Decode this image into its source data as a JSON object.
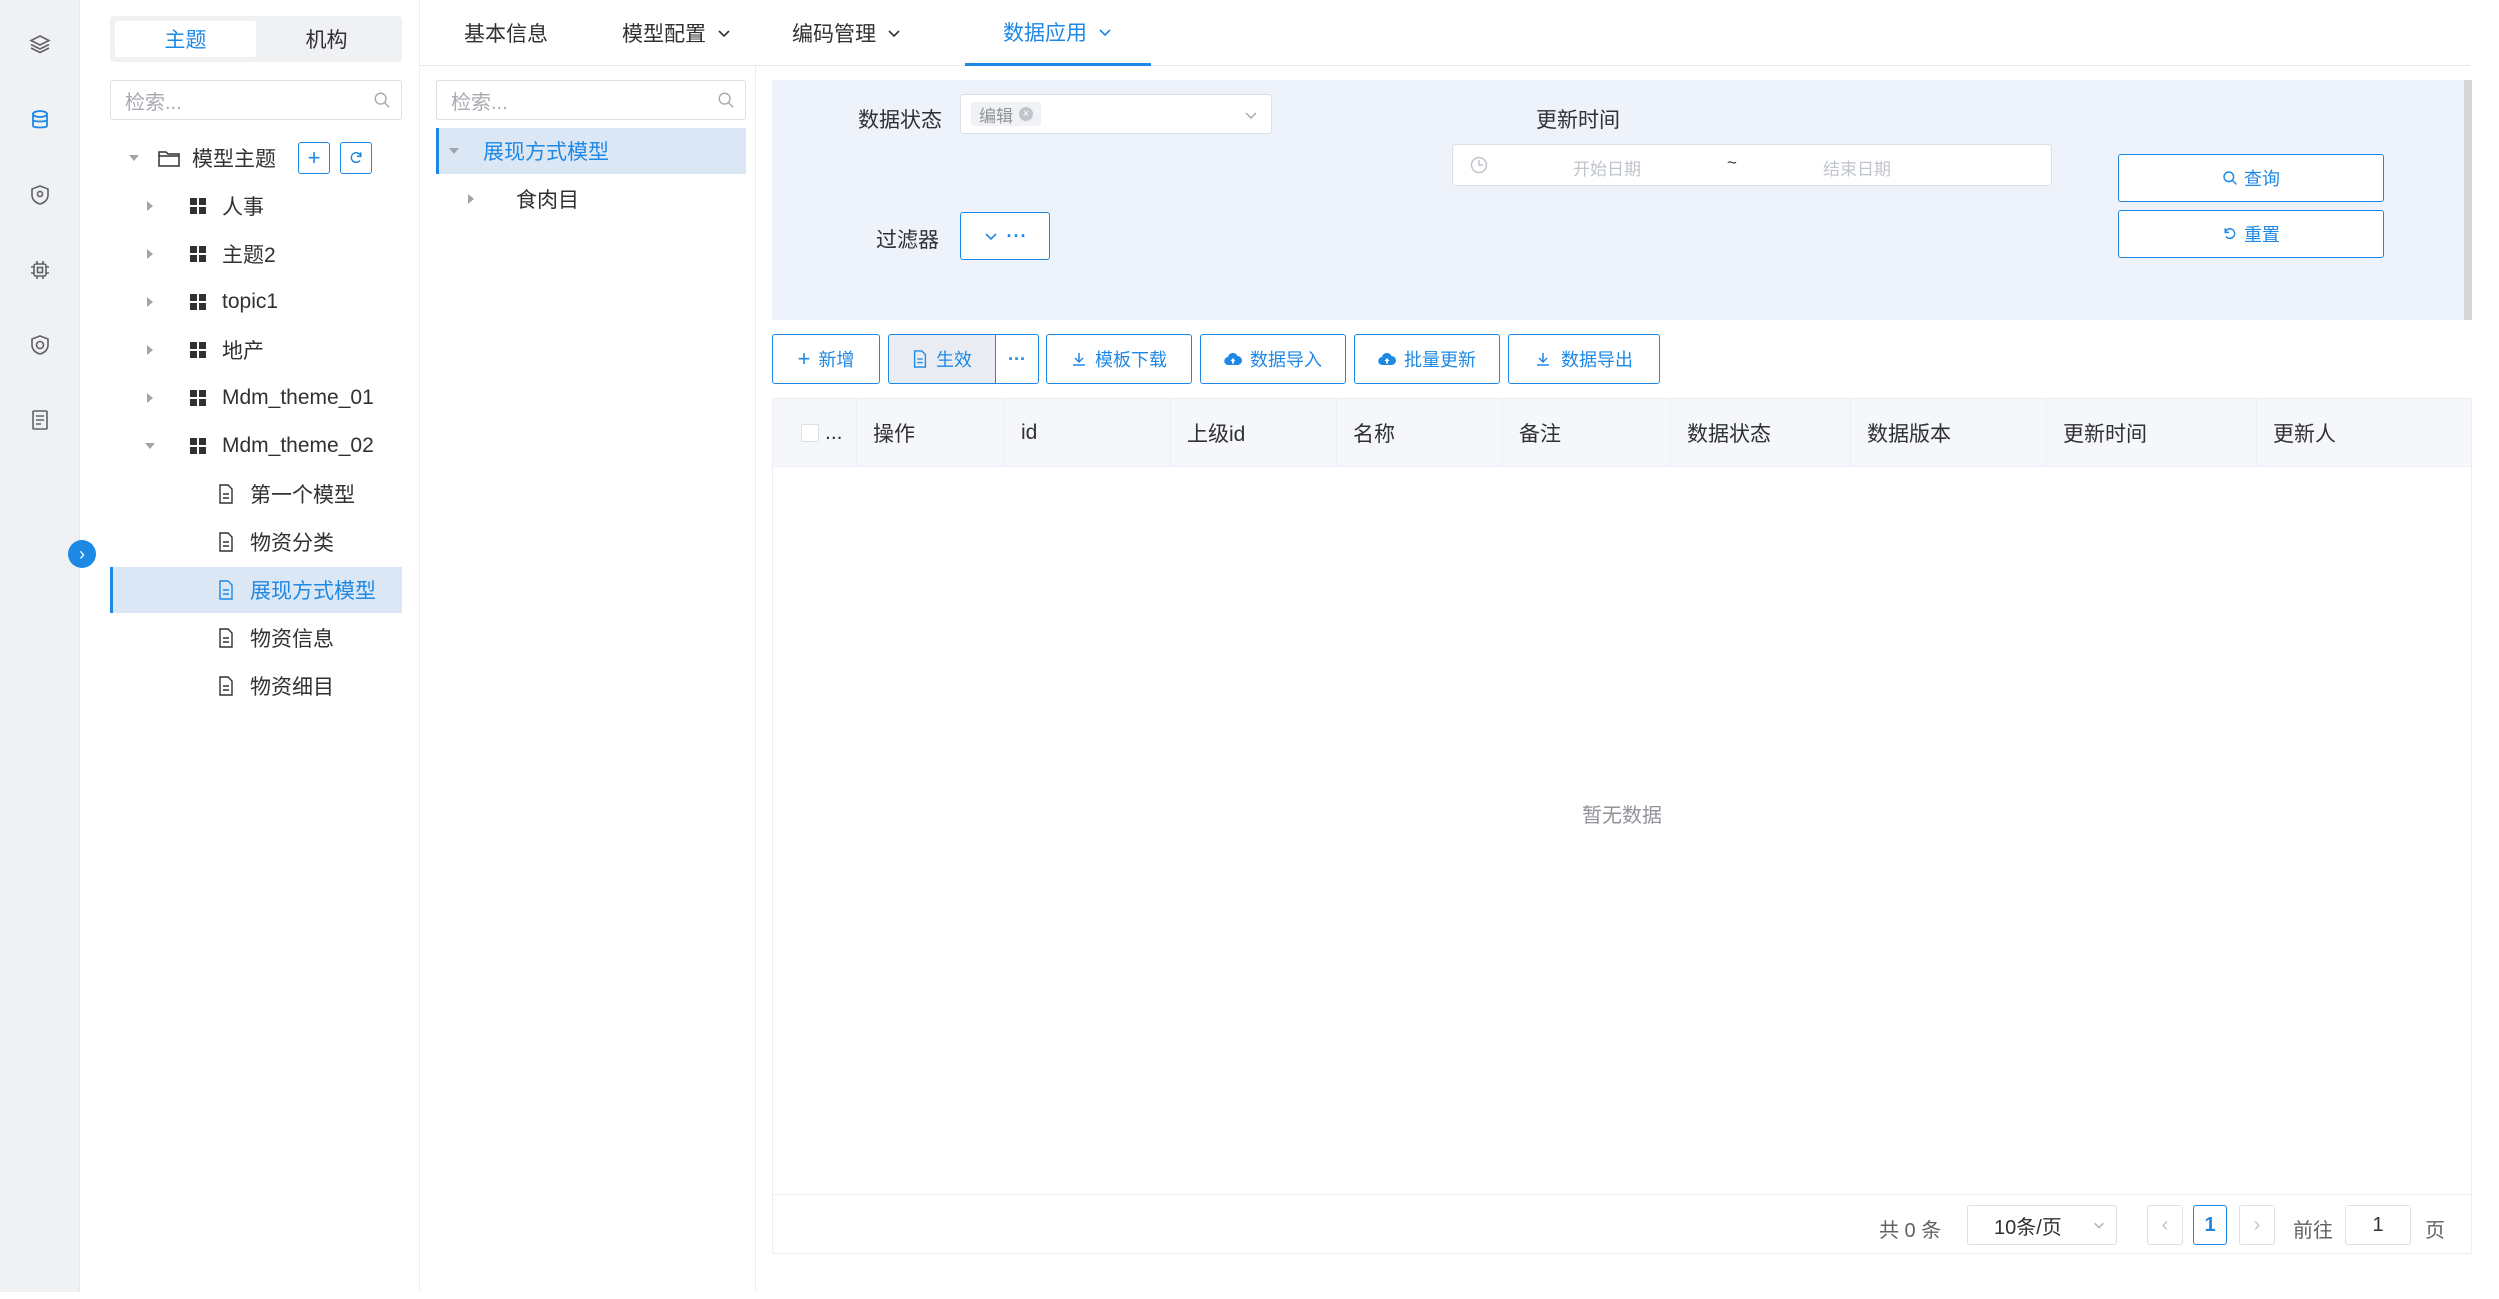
{
  "rail": {
    "icons": [
      "layers-icon",
      "database-icon",
      "shield-icon",
      "chip-icon",
      "security-icon",
      "document-list-icon"
    ]
  },
  "theme_panel": {
    "tabs": [
      "主题",
      "机构"
    ],
    "search_placeholder": "检索...",
    "root_label": "模型主题",
    "items": [
      {
        "label": "人事"
      },
      {
        "label": "主题2"
      },
      {
        "label": "topic1"
      },
      {
        "label": "地产"
      },
      {
        "label": "Mdm_theme_01"
      },
      {
        "label": "Mdm_theme_02"
      }
    ],
    "children": [
      "第一个模型",
      "物资分类",
      "展现方式模型",
      "物资信息",
      "物资细目"
    ]
  },
  "main_tabs": [
    "基本信息",
    "模型配置",
    "编码管理",
    "数据应用"
  ],
  "model_tree": {
    "search_placeholder": "检索...",
    "root": "展现方式模型",
    "child": "食肉目"
  },
  "filter": {
    "status_label": "数据状态",
    "status_tag": "编辑",
    "time_label": "更新时间",
    "start_placeholder": "开始日期",
    "separator": "~",
    "end_placeholder": "结束日期",
    "filter_label": "过滤器",
    "query_label": "查询",
    "reset_label": "重置"
  },
  "toolbar": {
    "add": "新增",
    "effect": "生效",
    "more": "···",
    "template_download": "模板下载",
    "data_import": "数据导入",
    "batch_update": "批量更新",
    "data_export": "数据导出"
  },
  "table": {
    "columns": [
      "...",
      "操作",
      "id",
      "上级id",
      "名称",
      "备注",
      "数据状态",
      "数据版本",
      "更新时间",
      "更新人"
    ],
    "empty_text": "暂无数据"
  },
  "pager": {
    "total": "共 0 条",
    "page_size": "10条/页",
    "current_page": "1",
    "goto_label": "前往",
    "goto_value": "1",
    "page_suffix": "页"
  },
  "colors": {
    "accent": "#1e88e5",
    "highlight_border": "#e53935",
    "filter_bg": "#eef3fb"
  }
}
